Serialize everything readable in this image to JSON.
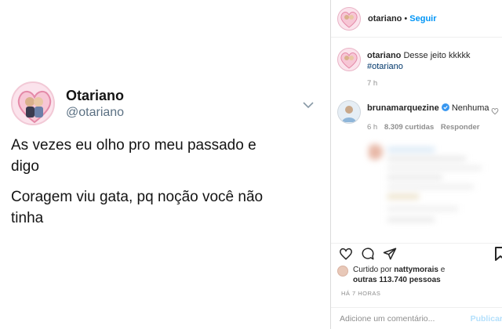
{
  "tweet": {
    "name": "Otariano",
    "handle": "@otariano",
    "line1": "As vezes eu olho pro meu passado e",
    "line2": "digo",
    "line3": "Coragem viu gata, pq noção você não",
    "line4": "tinha"
  },
  "header": {
    "username": "otariano",
    "separator": "•",
    "follow_label": "Seguir"
  },
  "caption": {
    "username": "otariano",
    "text": "Desse jeito kkkkk",
    "hashtag": "#otariano",
    "time": "7 h"
  },
  "top_comment": {
    "username": "brunamarquezine",
    "verified": true,
    "text": "Nenhuma",
    "time": "6 h",
    "likes": "8.309 curtidas",
    "reply_label": "Responder"
  },
  "likes": {
    "prefix": "Curtido por",
    "user": "nattymorais",
    "suffix": "e",
    "others": "outras 113.740 pessoas"
  },
  "timestamp": "HÁ 7 HORAS",
  "add_comment": {
    "placeholder": "Adicione um comentário...",
    "publish_label": "Publicar"
  },
  "colors": {
    "link_blue": "#0095f6",
    "hashtag_blue": "#00376b",
    "muted": "#8e8e8e"
  }
}
